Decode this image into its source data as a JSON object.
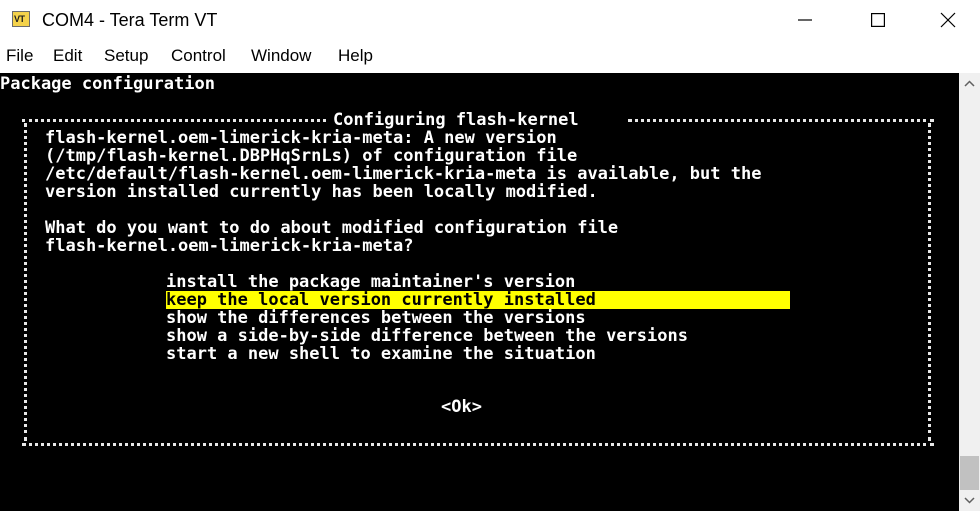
{
  "window": {
    "title": "COM4 - Tera Term VT",
    "icon_text": "VT"
  },
  "menu": [
    "File",
    "Edit",
    "Setup",
    "Control",
    "Window",
    "Help"
  ],
  "terminal": {
    "header": "Package configuration",
    "dialog_title": "Configuring flash-kernel",
    "body_lines": [
      "flash-kernel.oem-limerick-kria-meta: A new version",
      "(/tmp/flash-kernel.DBPHqSrnLs) of configuration file",
      "/etc/default/flash-kernel.oem-limerick-kria-meta is available, but the",
      "version installed currently has been locally modified."
    ],
    "question_lines": [
      "What do you want to do about modified configuration file",
      "flash-kernel.oem-limerick-kria-meta?"
    ],
    "options": [
      "install the package maintainer's version",
      "keep the local version currently installed",
      "show the differences between the versions",
      "show a side-by-side difference between the versions",
      "start a new shell to examine the situation"
    ],
    "selected_option_index": 1,
    "ok_label": "<Ok>"
  },
  "colors": {
    "terminal_bg": "#000000",
    "terminal_fg": "#ffffff",
    "highlight_bg": "#ffff00",
    "highlight_fg": "#000000"
  }
}
